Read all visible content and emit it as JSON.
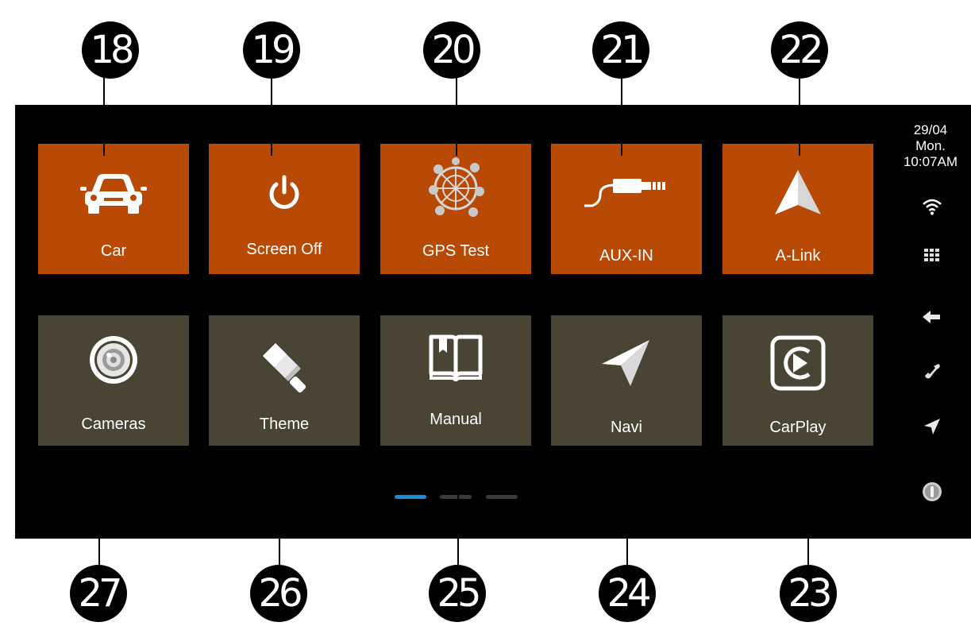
{
  "callouts_top": [
    "18",
    "19",
    "20",
    "21",
    "22"
  ],
  "callouts_bottom": [
    "27",
    "26",
    "25",
    "24",
    "23"
  ],
  "status": {
    "date": "29/04",
    "day": "Mon.",
    "time": "10:07AM"
  },
  "tiles_row1": [
    {
      "label": "Car",
      "icon": "car-icon"
    },
    {
      "label": "Screen Off",
      "icon": "power-icon"
    },
    {
      "label": "GPS Test",
      "icon": "satellite-globe-icon"
    },
    {
      "label": "AUX-IN",
      "icon": "aux-cable-icon"
    },
    {
      "label": "A-Link",
      "icon": "navigation-arrow-icon"
    }
  ],
  "tiles_row2": [
    {
      "label": "Cameras",
      "icon": "camera-lens-icon"
    },
    {
      "label": "Theme",
      "icon": "paint-brush-icon"
    },
    {
      "label": "Manual",
      "icon": "book-icon"
    },
    {
      "label": "Navi",
      "icon": "paper-plane-icon"
    },
    {
      "label": "CarPlay",
      "icon": "carplay-icon"
    }
  ],
  "sidebar_icons": [
    "wifi-icon",
    "apps-grid-icon",
    "back-arrow-icon",
    "phone-icon",
    "navigation-icon",
    "music-icon"
  ],
  "page_indicator": {
    "pages": 3,
    "active": 1
  },
  "colors": {
    "tile_primary": "#b94a06",
    "tile_secondary": "#4a4435",
    "screen_bg": "#000000",
    "indicator_active": "#1a8fd6",
    "indicator_inactive": "#3a3a3a"
  }
}
